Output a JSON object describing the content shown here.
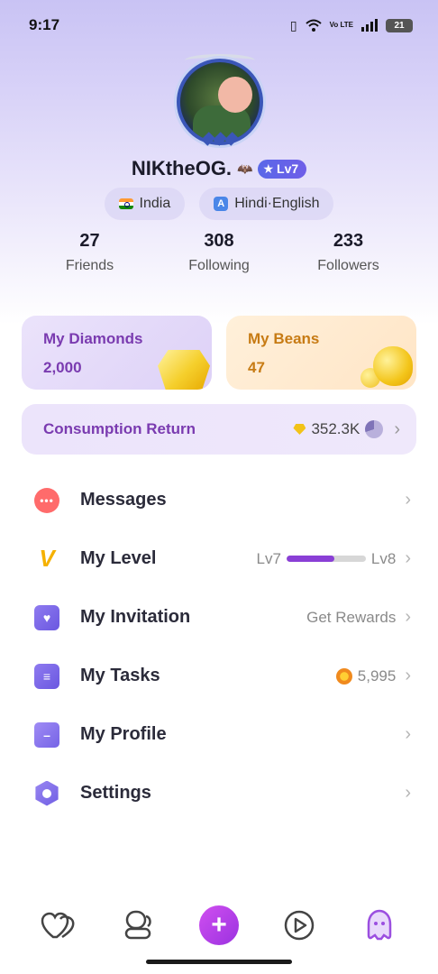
{
  "status_bar": {
    "time": "9:17",
    "battery": "21",
    "volte": "Vo LTE"
  },
  "profile": {
    "username": "NIKtheOG.",
    "level_badge": "Lv7",
    "country": "India",
    "languages": "Hindi·English",
    "stats": [
      {
        "value": "27",
        "label": "Friends"
      },
      {
        "value": "308",
        "label": "Following"
      },
      {
        "value": "233",
        "label": "Followers"
      }
    ]
  },
  "wallet": {
    "diamonds": {
      "title": "My Diamonds",
      "value": "2,000"
    },
    "beans": {
      "title": "My Beans",
      "value": "47"
    }
  },
  "consumption": {
    "title": "Consumption Return",
    "value": "352.3K"
  },
  "menu": {
    "messages": {
      "label": "Messages"
    },
    "level": {
      "label": "My Level",
      "current": "Lv7",
      "next": "Lv8",
      "progress": 0.6
    },
    "invitation": {
      "label": "My Invitation",
      "right_text": "Get Rewards"
    },
    "tasks": {
      "label": "My Tasks",
      "coins": "5,995"
    },
    "profile": {
      "label": "My Profile"
    },
    "settings": {
      "label": "Settings"
    }
  },
  "icons": {
    "nav": [
      "hearts-icon",
      "friends-icon",
      "plus-icon",
      "play-icon",
      "ghost-profile-icon"
    ]
  },
  "colors": {
    "accent_purple": "#7a3bb0",
    "beans_orange": "#c77b14",
    "plus_button": "#c046ec"
  }
}
